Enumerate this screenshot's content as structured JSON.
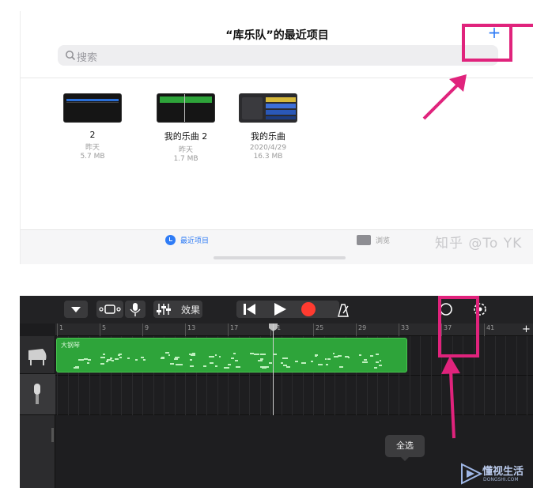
{
  "browser": {
    "title": "“库乐队”的最近项目",
    "add_label": "+",
    "search_placeholder": "搜索",
    "projects": [
      {
        "name": "2",
        "date": "昨天",
        "size": "5.7 MB"
      },
      {
        "name": "我的乐曲 2",
        "date": "昨天",
        "size": "1.7 MB"
      },
      {
        "name": "我的乐曲",
        "date": "2020/4/29",
        "size": "16.3 MB"
      }
    ],
    "tabs": {
      "recent": "最近项目",
      "browse": "浏览"
    },
    "watermark": "知乎 @To YK"
  },
  "garageband": {
    "toolbar": {
      "effects_label": "效果"
    },
    "ruler": [
      "1",
      "5",
      "9",
      "13",
      "17",
      "21",
      "25",
      "29",
      "33",
      "37",
      "41"
    ],
    "add_track_label": "+",
    "region_name": "大钢琴",
    "tooltip": "全选",
    "logo_text": "懂视生活",
    "logo_sub": "DONGSHI.COM"
  },
  "colors": {
    "accent": "#2f7cf6",
    "annotation": "#e0237c",
    "region": "#2ea43a",
    "record": "#ff3b30"
  }
}
